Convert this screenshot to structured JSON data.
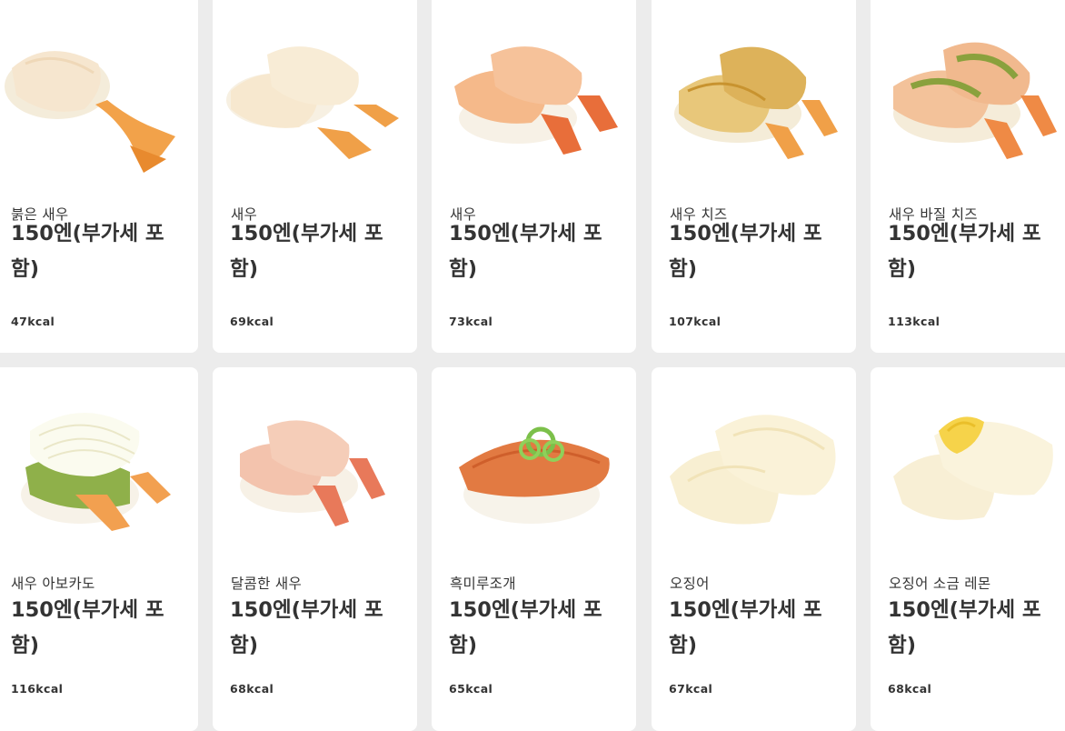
{
  "items": [
    {
      "name": "붉은 새우",
      "price": "150엔(부가세 포함)",
      "kcal": "47kcal",
      "image": "red-shrimp-nigiri"
    },
    {
      "name": "새우",
      "price": "150엔(부가세 포함)",
      "kcal": "69kcal",
      "image": "shrimp-nigiri"
    },
    {
      "name": "새우",
      "price": "150엔(부가세 포함)",
      "kcal": "73kcal",
      "image": "boiled-shrimp-nigiri"
    },
    {
      "name": "새우 치즈",
      "price": "150엔(부가세 포함)",
      "kcal": "107kcal",
      "image": "shrimp-cheese-nigiri"
    },
    {
      "name": "새우 바질 치즈",
      "price": "150엔(부가세 포함)",
      "kcal": "113kcal",
      "image": "shrimp-basil-cheese-nigiri"
    },
    {
      "name": "새우 아보카도",
      "price": "150엔(부가세 포함)",
      "kcal": "116kcal",
      "image": "shrimp-avocado-nigiri"
    },
    {
      "name": "달콤한 새우",
      "price": "150엔(부가세 포함)",
      "kcal": "68kcal",
      "image": "sweet-shrimp-nigiri"
    },
    {
      "name": "흑미루조개",
      "price": "150엔(부가세 포함)",
      "kcal": "65kcal",
      "image": "surf-clam-nigiri"
    },
    {
      "name": "오징어",
      "price": "150엔(부가세 포함)",
      "kcal": "67kcal",
      "image": "squid-nigiri"
    },
    {
      "name": "오징어 소금 레몬",
      "price": "150엔(부가세 포함)",
      "kcal": "68kcal",
      "image": "squid-salt-lemon-nigiri"
    }
  ],
  "colors": {
    "page_background": "#ececec",
    "card_background": "#ffffff",
    "text": "#333333"
  }
}
